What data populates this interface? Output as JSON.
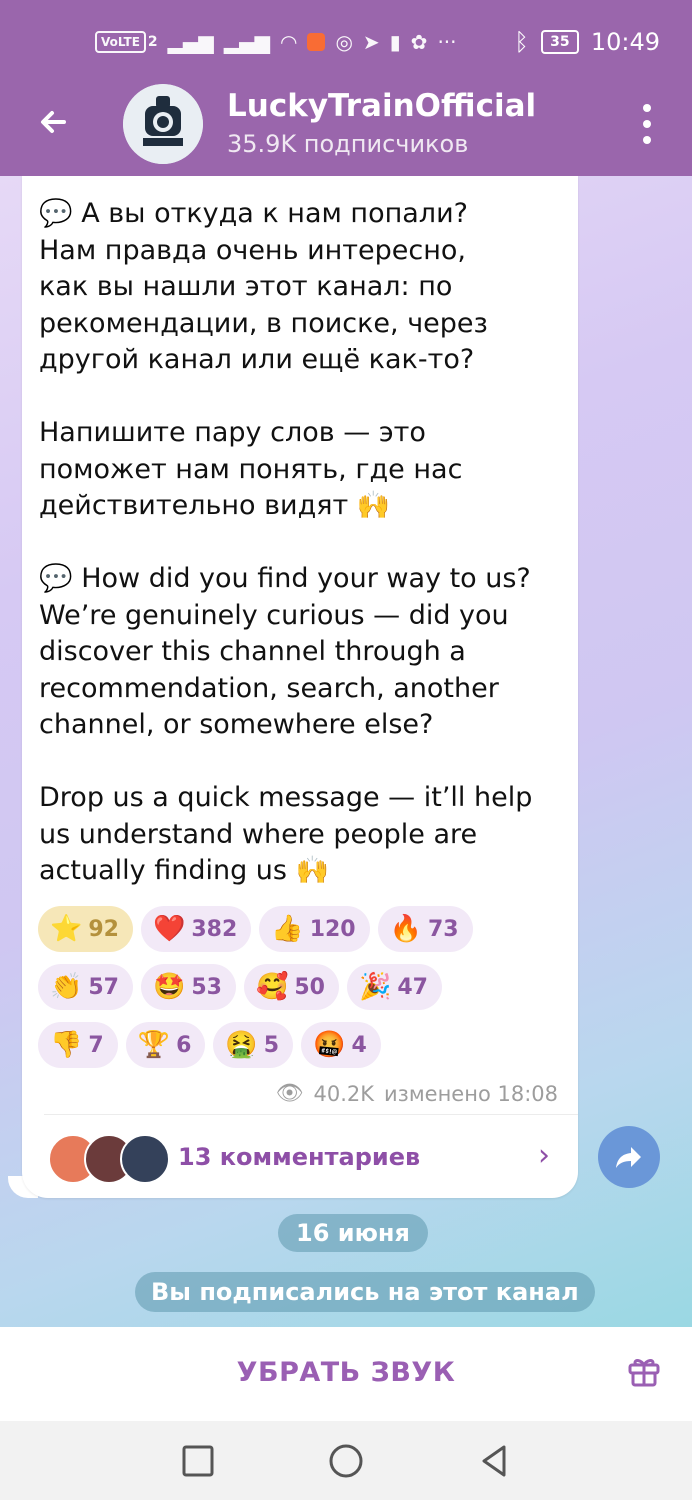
{
  "status_bar": {
    "volte": "VoLTE",
    "sim": "2",
    "battery": "35",
    "time": "10:49",
    "more": "···"
  },
  "header": {
    "back_icon": "arrow-left-icon",
    "channel_name": "LuckyTrainOfficial",
    "subscribers": "35.9K подписчиков",
    "menu_icon": "kebab-menu-icon"
  },
  "message": {
    "text": "💬 А вы откуда к нам попали?\nНам правда очень интересно,\nкак вы нашли этот канал: по\nрекомендации, в поиске, через\nдругой канал или ещё как-то?\n\nНапишите пару слов — это\nпоможет нам понять, где нас\nдействительно видят 🙌\n\n💬 How did you find your way to us?\nWe’re genuinely curious — did you\ndiscover this channel through a\nrecommendation, search, another\nchannel, or somewhere else?\n\nDrop us a quick message — it’ll help\nus understand where people are\nactually finding us 🙌",
    "reactions": [
      {
        "emoji": "⭐",
        "count": "92",
        "active": true
      },
      {
        "emoji": "❤️",
        "count": "382"
      },
      {
        "emoji": "👍",
        "count": "120"
      },
      {
        "emoji": "🔥",
        "count": "73"
      },
      {
        "emoji": "👏",
        "count": "57"
      },
      {
        "emoji": "🤩",
        "count": "53"
      },
      {
        "emoji": "🥰",
        "count": "50"
      },
      {
        "emoji": "🎉",
        "count": "47"
      },
      {
        "emoji": "👎",
        "count": "7"
      },
      {
        "emoji": "🏆",
        "count": "6"
      },
      {
        "emoji": "🤮",
        "count": "5"
      },
      {
        "emoji": "🤬",
        "count": "4"
      }
    ],
    "views": "40.2K",
    "edited": "изменено 18:08",
    "comments_label": "13 комментариев"
  },
  "date_pill": "16 июня",
  "service_message": "Вы подписались на этот канал",
  "bottom": {
    "mute_label": "УБРАТЬ ЗВУК",
    "gift_icon": "gift-icon"
  },
  "colors": {
    "header": "#9a66ac",
    "accent": "#8e4fa7",
    "active_reaction": "#f6e7b8"
  }
}
